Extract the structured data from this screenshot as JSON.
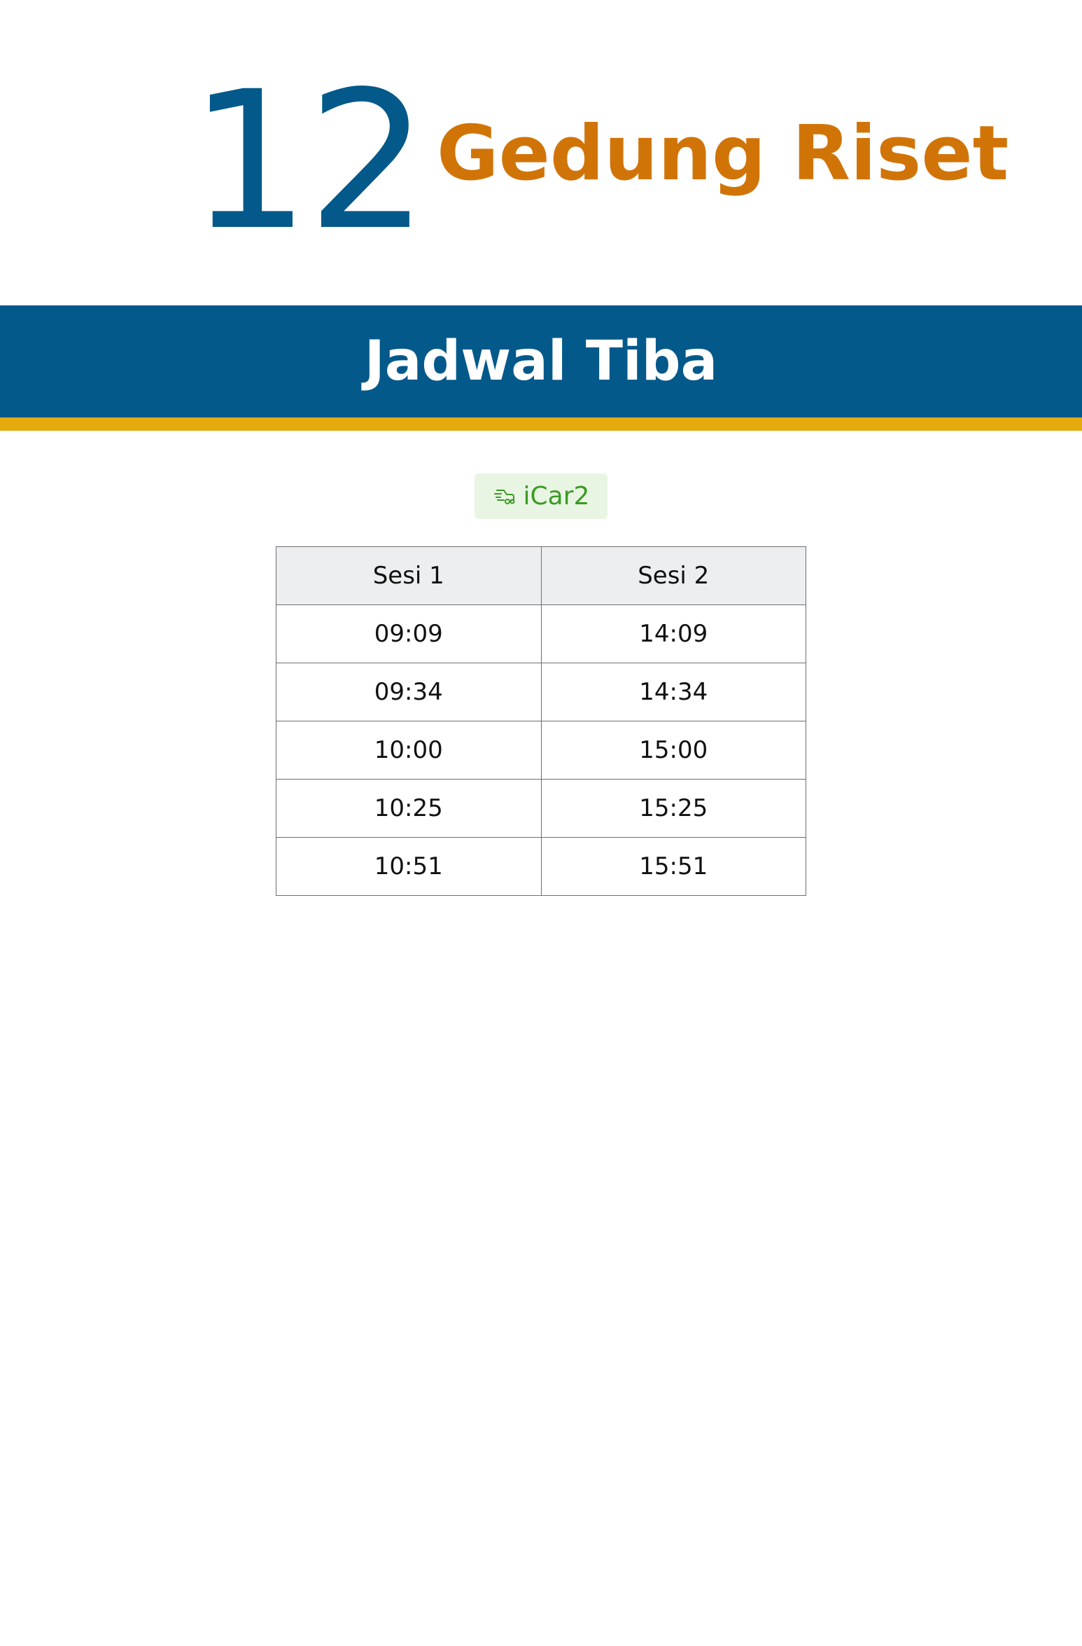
{
  "stop": {
    "number": "12",
    "name": "Gedung Riset"
  },
  "banner": {
    "title": "Jadwal Tiba"
  },
  "route": {
    "label": "iCar2",
    "icon": "car-icon",
    "color": "#3a9a23"
  },
  "schedule": {
    "headers": [
      "Sesi 1",
      "Sesi 2"
    ],
    "rows": [
      [
        "09:09",
        "14:09"
      ],
      [
        "09:34",
        "14:34"
      ],
      [
        "10:00",
        "15:00"
      ],
      [
        "10:25",
        "15:25"
      ],
      [
        "10:51",
        "15:51"
      ]
    ]
  },
  "colors": {
    "primary": "#03598a",
    "accent": "#d17408",
    "stripe": "#e4aa0e"
  }
}
